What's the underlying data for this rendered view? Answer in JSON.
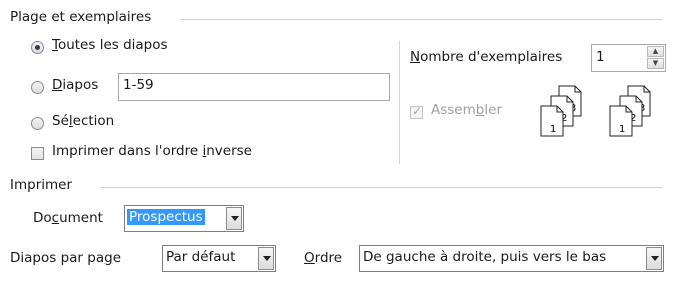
{
  "range": {
    "title": "Plage et exemplaires",
    "options": [
      {
        "label": "Toutes les diapos",
        "checked": true
      },
      {
        "label": "Diapos",
        "checked": false
      },
      {
        "label": "Sélection",
        "checked": false
      }
    ],
    "slides_value": "1-59",
    "reverse_label": "Imprimer dans l'ordre inverse",
    "reverse_checked": false
  },
  "copies": {
    "label": "Nombre d'exemplaires",
    "value": "1",
    "collate_label": "Assembler",
    "collate_checked": true,
    "collate_enabled": false,
    "icon_pages": [
      "1",
      "2",
      "3"
    ]
  },
  "print": {
    "title": "Imprimer",
    "document_label": "Document",
    "document_value": "Prospectus",
    "slides_per_page_label": "Diapos par page",
    "slides_per_page_value": "Par défaut",
    "order_label": "Ordre",
    "order_value": "De gauche à droite, puis vers le bas"
  }
}
